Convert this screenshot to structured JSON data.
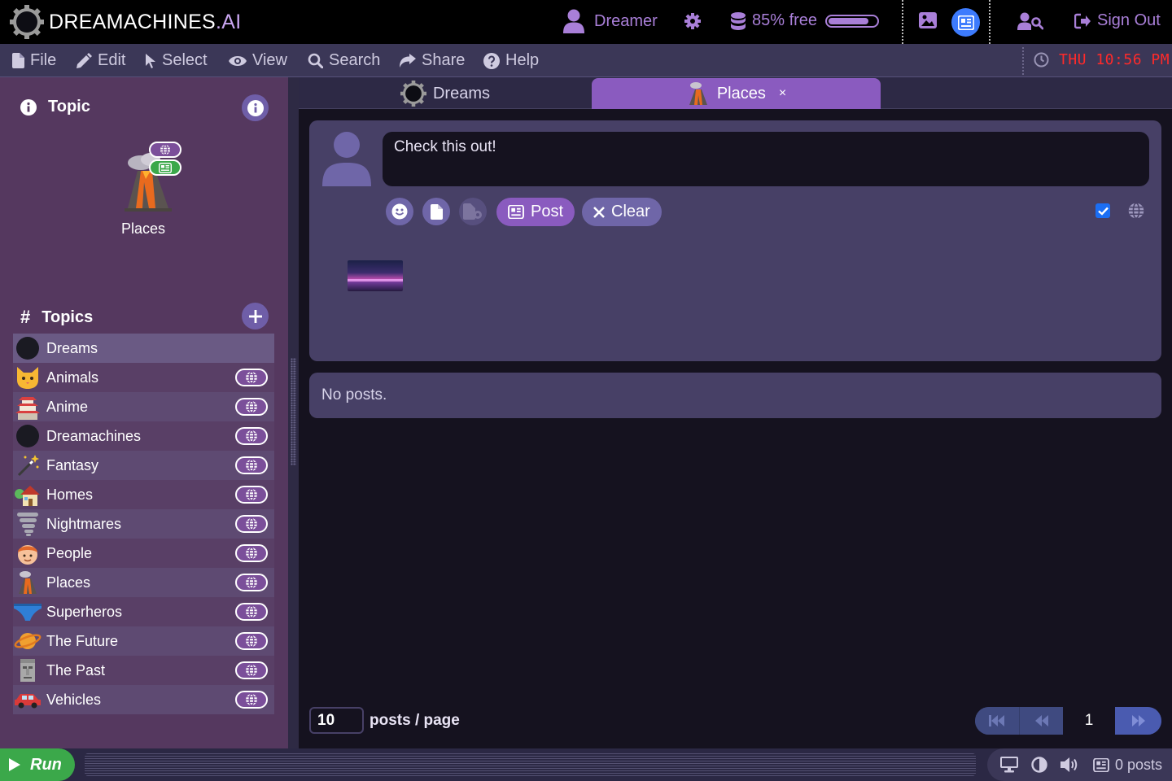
{
  "brand": {
    "name_main": "DREAMACHINES",
    "name_suffix": ".AI"
  },
  "topbar": {
    "user_label": "Dreamer",
    "storage_label": "85% free",
    "storage_fraction": 0.85,
    "signout_label": "Sign Out",
    "icons": [
      "user-icon",
      "gear-icon",
      "database-icon",
      "image-icon",
      "newspaper-icon",
      "user-search-icon",
      "sign-out-icon"
    ]
  },
  "menu": {
    "items": [
      {
        "label": "File",
        "icon": "file-icon"
      },
      {
        "label": "Edit",
        "icon": "pencil-icon"
      },
      {
        "label": "Select",
        "icon": "cursor-icon"
      },
      {
        "label": "View",
        "icon": "eye-icon"
      },
      {
        "label": "Search",
        "icon": "search-icon"
      },
      {
        "label": "Share",
        "icon": "share-icon"
      },
      {
        "label": "Help",
        "icon": "help-icon"
      }
    ],
    "clock": "THU 10:56 PM"
  },
  "sidebar": {
    "topic_heading": "Topic",
    "selected_topic": "Places",
    "topics_heading": "Topics",
    "topics": [
      {
        "label": "Dreams",
        "icon": "moon-icon",
        "public": false
      },
      {
        "label": "Animals",
        "icon": "cat-icon",
        "public": true
      },
      {
        "label": "Anime",
        "icon": "castle-icon",
        "public": true
      },
      {
        "label": "Dreamachines",
        "icon": "moon-icon",
        "public": true
      },
      {
        "label": "Fantasy",
        "icon": "magic-wand-icon",
        "public": true
      },
      {
        "label": "Homes",
        "icon": "house-icon",
        "public": true
      },
      {
        "label": "Nightmares",
        "icon": "tornado-icon",
        "public": true
      },
      {
        "label": "People",
        "icon": "person-icon",
        "public": true
      },
      {
        "label": "Places",
        "icon": "volcano-icon",
        "public": true
      },
      {
        "label": "Superheros",
        "icon": "briefs-icon",
        "public": true
      },
      {
        "label": "The Future",
        "icon": "planet-icon",
        "public": true
      },
      {
        "label": "The Past",
        "icon": "moai-icon",
        "public": true
      },
      {
        "label": "Vehicles",
        "icon": "car-icon",
        "public": true
      }
    ]
  },
  "tabs": [
    {
      "label": "Dreams",
      "active": false
    },
    {
      "label": "Places",
      "active": true,
      "close": "×"
    }
  ],
  "composer": {
    "text": "Check this out!",
    "post_label": "Post",
    "clear_label": "Clear",
    "public_checked": true
  },
  "posts": {
    "empty_text": "No posts."
  },
  "pagination": {
    "per_page": "10",
    "per_page_label": "posts / page",
    "current_page": "1"
  },
  "statusbar": {
    "run_label": "Run",
    "posts_count": "0 posts"
  },
  "colors": {
    "accent": "#8a5bbf",
    "brand_purple": "#a97fd8",
    "clock_red": "#ff2a2a",
    "run_green": "#3ba84a",
    "check_blue": "#1b6ef3"
  }
}
